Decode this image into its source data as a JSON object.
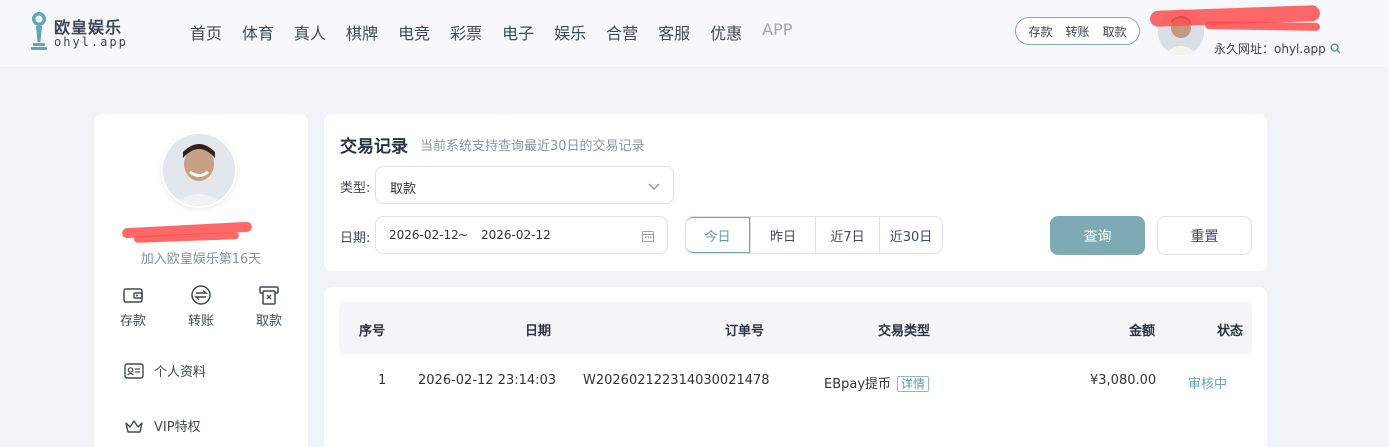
{
  "header": {
    "logo_title": "欧皇娱乐",
    "logo_sub": "ohyl.app",
    "nav": [
      "首页",
      "体育",
      "真人",
      "棋牌",
      "电竞",
      "彩票",
      "电子",
      "娱乐",
      "合营",
      "客服",
      "优惠",
      "APP"
    ],
    "fund_actions": [
      "存款",
      "转账",
      "取款"
    ],
    "site_url": "永久网址：ohyl.app"
  },
  "sidebar": {
    "join_text": "加入欧皇娱乐第16天",
    "quick_actions": [
      {
        "label": "存款",
        "icon": "wallet-icon"
      },
      {
        "label": "转账",
        "icon": "transfer-icon"
      },
      {
        "label": "取款",
        "icon": "withdraw-icon"
      }
    ],
    "menu": [
      {
        "label": "个人资料",
        "icon": "id-card-icon"
      },
      {
        "label": "VIP特权",
        "icon": "crown-icon"
      }
    ]
  },
  "filter": {
    "title": "交易记录",
    "subtitle": "当前系统支持查询最近30日的交易记录",
    "type_label": "类型:",
    "type_value": "取款",
    "date_label": "日期:",
    "date_start": "2026-02-12",
    "date_sep": "~",
    "date_end": "2026-02-12",
    "quick_ranges": [
      "今日",
      "昨日",
      "近7日",
      "近30日"
    ],
    "active_range": "今日",
    "query_label": "查询",
    "reset_label": "重置"
  },
  "table": {
    "headers": [
      "序号",
      "日期",
      "订单号",
      "交易类型",
      "金额",
      "状态"
    ],
    "rows": [
      {
        "index": "1",
        "date": "2026-02-12 23:14:03",
        "order_no": "W202602122314030021478",
        "type": "EBpay提币",
        "detail": "详情",
        "amount": "¥3,080.00",
        "status": "审核中"
      }
    ]
  },
  "colors": {
    "accent": "#7eaab6",
    "active_text": "#5e9aae",
    "redaction": "#ff4d4d"
  }
}
